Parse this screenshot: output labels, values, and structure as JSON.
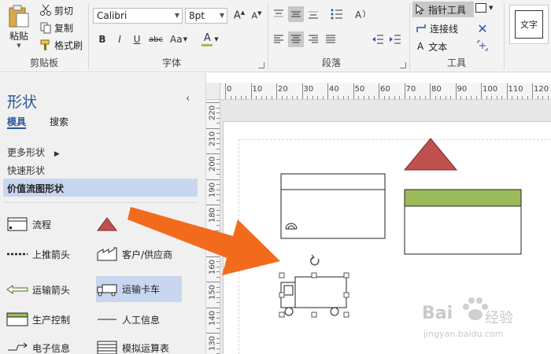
{
  "ribbon": {
    "clipboard": {
      "paste_label": "粘贴",
      "cut_label": "剪切",
      "copy_label": "复制",
      "format_painter_label": "格式刷",
      "group_label": "剪贴板"
    },
    "font": {
      "font_name": "Calibri",
      "font_size": "8pt",
      "bold": "B",
      "italic": "I",
      "underline": "U",
      "strikethrough": "abc",
      "change_case": "Aa",
      "font_color": "A",
      "group_label": "字体"
    },
    "paragraph": {
      "group_label": "段落"
    },
    "tools": {
      "pointer_tool_label": "指针工具",
      "connector_label": "连接线",
      "text_label": "文本",
      "group_label": "工具"
    },
    "shape_styles": {
      "text_preview": "文字"
    }
  },
  "shapes_pane": {
    "title": "形状",
    "tabs": {
      "stencils": "模具",
      "search": "搜索"
    },
    "more_shapes": "更多形状",
    "quick_shapes": "快速形状",
    "active_stencil": "价值流图形状",
    "items": [
      {
        "label": "流程",
        "icon": "process-box-icon"
      },
      {
        "label": "",
        "icon": "red-triangle-icon"
      },
      {
        "label": "上推箭头",
        "icon": "push-arrow-icon"
      },
      {
        "label": "客户/供应商",
        "icon": "factory-icon"
      },
      {
        "label": "运输箭头",
        "icon": "shipment-arrow-icon"
      },
      {
        "label": "运输卡车",
        "icon": "truck-icon"
      },
      {
        "label": "生产控制",
        "icon": "production-control-icon"
      },
      {
        "label": "人工信息",
        "icon": "manual-info-icon"
      },
      {
        "label": "电子信息",
        "icon": "electronic-info-icon"
      },
      {
        "label": "模拟运算表",
        "icon": "data-table-icon"
      }
    ]
  },
  "rulers": {
    "top": [
      "0",
      "10",
      "20",
      "30",
      "40",
      "50",
      "60",
      "70",
      "80",
      "90",
      "100",
      "110",
      "120"
    ],
    "left": [
      "220",
      "210",
      "200",
      "190",
      "180",
      "170",
      "160",
      "150",
      "140",
      "130"
    ]
  },
  "watermark": {
    "brand": "Bai",
    "brand_cn": "经验",
    "url": "jingyan.baidu.com"
  },
  "colors": {
    "accent_blue": "#2b579a",
    "selection_blue": "#c8d6ef",
    "triangle_red": "#c0504d",
    "header_green": "#9bbb59",
    "arrow_orange": "#f26b1d"
  }
}
